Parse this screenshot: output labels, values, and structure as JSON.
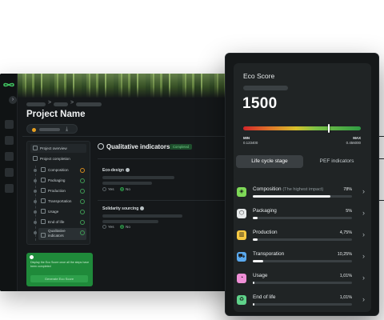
{
  "project": {
    "title": "Project Name",
    "breadcrumb_separators": [
      ">",
      ">"
    ],
    "download_glyph": "⤓"
  },
  "tree": {
    "top_items": [
      "Project overview",
      "Project completion"
    ],
    "sub_items": [
      {
        "label": "Composition",
        "status": "warn",
        "icon": "composition-icon"
      },
      {
        "label": "Packaging",
        "status": "ok",
        "icon": "packaging-icon"
      },
      {
        "label": "Production",
        "status": "ok",
        "icon": "production-icon"
      },
      {
        "label": "Transportation",
        "status": "ok",
        "icon": "transportation-icon"
      },
      {
        "label": "Usage",
        "status": "ok",
        "icon": "usage-icon"
      },
      {
        "label": "End of life",
        "status": "ok",
        "icon": "end-of-life-icon"
      },
      {
        "label": "Qualitative indicators",
        "status": "ok",
        "icon": "qualitative-icon"
      }
    ]
  },
  "green_card": {
    "text": "Display the Eco Score once all the steps have been completed",
    "button": "Generate Eco Score"
  },
  "qualitative": {
    "title": "Qualitative indicators",
    "badge": "Completed",
    "questions": [
      {
        "label": "Eco-design",
        "options": [
          "Yes",
          "No"
        ],
        "selected": "No"
      },
      {
        "label": "Solidarity sourcing",
        "options": [
          "Yes",
          "No"
        ],
        "selected": "No"
      }
    ]
  },
  "eco_score": {
    "title": "Eco Score",
    "value": "1500",
    "gauge_position": 0.72,
    "min_label": "MIN",
    "min_value": "0.123400",
    "max_label": "MAX",
    "max_value": "0.456000"
  },
  "tabs": {
    "active": "Life cycle stage",
    "inactive": "PEF indicators"
  },
  "stages": [
    {
      "label": "Composition",
      "note": "(The highest impact)",
      "pct_text": "78%",
      "fraction": 0.78,
      "icon": "composition-icon",
      "color": "#7ed957",
      "glyph": "◈"
    },
    {
      "label": "Packaging",
      "note": "",
      "pct_text": "5%",
      "fraction": 0.05,
      "icon": "packaging-icon",
      "color": "#e6e9ea",
      "glyph": "⬡"
    },
    {
      "label": "Production",
      "note": "",
      "pct_text": "4,75%",
      "fraction": 0.0475,
      "icon": "production-icon",
      "color": "#f5c842",
      "glyph": "▥"
    },
    {
      "label": "Transporation",
      "note": "",
      "pct_text": "10,25%",
      "fraction": 0.1025,
      "icon": "transportation-icon",
      "color": "#5aa9ee",
      "glyph": "⛟"
    },
    {
      "label": "Usage",
      "note": "",
      "pct_text": "1,01%",
      "fraction": 0.0101,
      "icon": "usage-icon",
      "color": "#ef8fd6",
      "glyph": "◔"
    },
    {
      "label": "End of life",
      "note": "",
      "pct_text": "1,01%",
      "fraction": 0.0101,
      "icon": "end-of-life-icon",
      "color": "#5fd38a",
      "glyph": "♻"
    }
  ],
  "row_chevron": "›"
}
